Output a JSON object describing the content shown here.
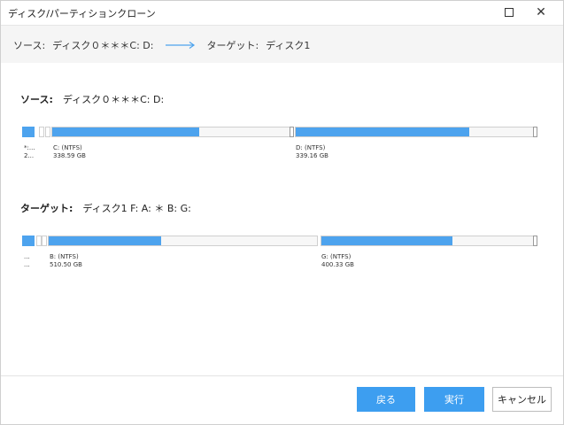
{
  "window": {
    "title": "ディスク/パーティションクローン"
  },
  "path": {
    "source_label": "ソース:",
    "source_value": "ディスク０＊＊＊C: D:",
    "target_label": "ターゲット:",
    "target_value": "ディスク1"
  },
  "source": {
    "heading_bold": "ソース:",
    "heading_rest": "ディスク０＊＊＊C: D:",
    "first_small": {
      "line1": "*:...",
      "line2": "2..."
    },
    "partitions": [
      {
        "name": "C: (NTFS)",
        "size": "338.59 GB",
        "used_fraction": 0.62
      },
      {
        "name": "D: (NTFS)",
        "size": "339.16 GB",
        "used_fraction": 0.73
      }
    ]
  },
  "target": {
    "heading_bold": "ターゲット:",
    "heading_rest": "ディスク1 F: A: ＊ B: G:",
    "first_small": {
      "line1": "...",
      "line2": "..."
    },
    "partitions": [
      {
        "name": "B: (NTFS)",
        "size": "510.50 GB",
        "used_fraction": 0.42
      },
      {
        "name": "G: (NTFS)",
        "size": "400.33 GB",
        "used_fraction": 0.62
      }
    ]
  },
  "buttons": {
    "back": "戻る",
    "execute": "実行",
    "cancel": "キャンセル"
  },
  "colors": {
    "accent": "#3d9ef0",
    "bar_fill": "#4da3ee"
  },
  "icons": {
    "maximize": "maximize-icon",
    "close": "close-icon",
    "arrow": "arrow-right-icon"
  }
}
